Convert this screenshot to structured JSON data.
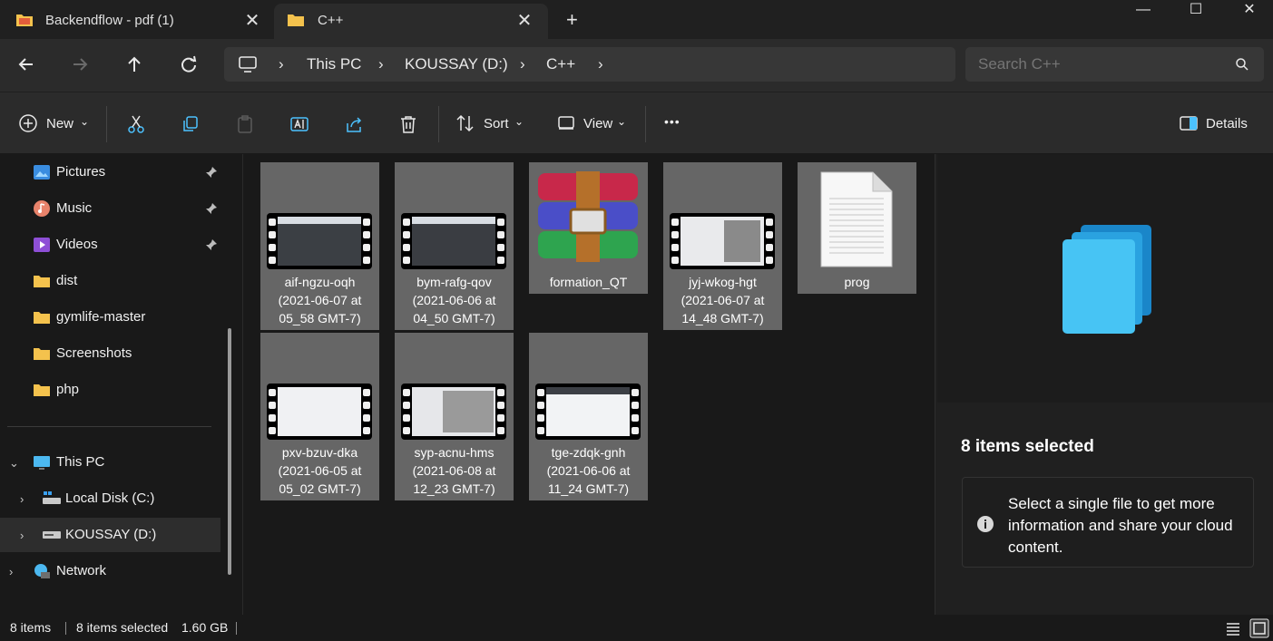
{
  "tabs": [
    {
      "label": "Backendflow - pdf (1)",
      "active": false
    },
    {
      "label": "C++",
      "active": true
    }
  ],
  "new_tab_symbol": "+",
  "window_controls": {
    "minimize": "—",
    "maximize": "☐",
    "close": "✕"
  },
  "breadcrumb": [
    "This PC",
    "KOUSSAY (D:)",
    "C++"
  ],
  "search": {
    "placeholder": "Search C++"
  },
  "toolbar": {
    "new_label": "New",
    "sort_label": "Sort",
    "view_label": "View",
    "more_label": "•••",
    "details_label": "Details"
  },
  "sidebar": {
    "quick": [
      {
        "label": "Pictures",
        "icon": "pictures-icon",
        "pinned": true
      },
      {
        "label": "Music",
        "icon": "music-icon",
        "pinned": true
      },
      {
        "label": "Videos",
        "icon": "videos-icon",
        "pinned": true
      },
      {
        "label": "dist",
        "icon": "folder-icon",
        "pinned": false
      },
      {
        "label": "gymlife-master",
        "icon": "folder-icon",
        "pinned": false
      },
      {
        "label": "Screenshots",
        "icon": "folder-icon",
        "pinned": false
      },
      {
        "label": "php",
        "icon": "folder-icon",
        "pinned": false
      }
    ],
    "this_pc": "This PC",
    "drives": [
      "Local Disk (C:)",
      "KOUSSAY (D:)"
    ],
    "network": "Network"
  },
  "files": [
    {
      "name": "aif-ngzu-oqh",
      "date": "(2021-06-07 at",
      "time": "05_58 GMT-7)",
      "type": "video"
    },
    {
      "name": "bym-rafg-qov",
      "date": "(2021-06-06 at",
      "time": "04_50 GMT-7)",
      "type": "video"
    },
    {
      "name": "formation_QT",
      "date": "",
      "time": "",
      "type": "archive"
    },
    {
      "name": "jyj-wkog-hgt",
      "date": "(2021-06-07 at",
      "time": "14_48 GMT-7)",
      "type": "video"
    },
    {
      "name": "prog",
      "date": "",
      "time": "",
      "type": "document"
    },
    {
      "name": "pxv-bzuv-dka",
      "date": "(2021-06-05 at",
      "time": "05_02 GMT-7)",
      "type": "video"
    },
    {
      "name": "syp-acnu-hms",
      "date": "(2021-06-08 at",
      "time": "12_23 GMT-7)",
      "type": "video"
    },
    {
      "name": "tge-zdqk-gnh",
      "date": "(2021-06-06 at",
      "time": "11_24 GMT-7)",
      "type": "video"
    }
  ],
  "details": {
    "title": "8 items selected",
    "info": "Select a single file to get more information and share your cloud content."
  },
  "status": {
    "count": "8 items",
    "selected": "8 items selected",
    "size": "1.60 GB"
  },
  "colors": {
    "accent": "#4cc2ff",
    "tile_selected": "#666666",
    "background": "#191919"
  }
}
